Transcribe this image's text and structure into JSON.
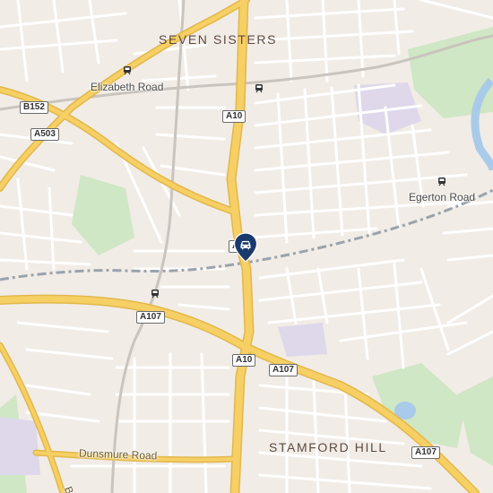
{
  "map": {
    "districts": {
      "seven_sisters": "SEVEN SISTERS",
      "stamford_hill": "STAMFORD HILL"
    },
    "places": {
      "elizabeth_road": "Elizabeth Road",
      "egerton_road": "Egerton Road"
    },
    "streets": {
      "dunsmure_road": "Dunsmure Road"
    },
    "road_shields": {
      "b152": "B152",
      "a503": "A503",
      "a10_north": "A10",
      "a10_center": "A10",
      "a107_west": "A107",
      "a10_south": "A10",
      "a107_center": "A107",
      "a107_east": "A107"
    },
    "edge_label": "B",
    "marker": {
      "icon": "car-icon"
    },
    "colors": {
      "land": "#f1ece6",
      "block": "#e8e0d8",
      "minor_road": "#ffffff",
      "major_road": "#f6cf65",
      "park": "#cfe7c4",
      "water": "#a9cbe9",
      "rail": "#9aa3ad",
      "marker": "#1a3a6e"
    }
  }
}
